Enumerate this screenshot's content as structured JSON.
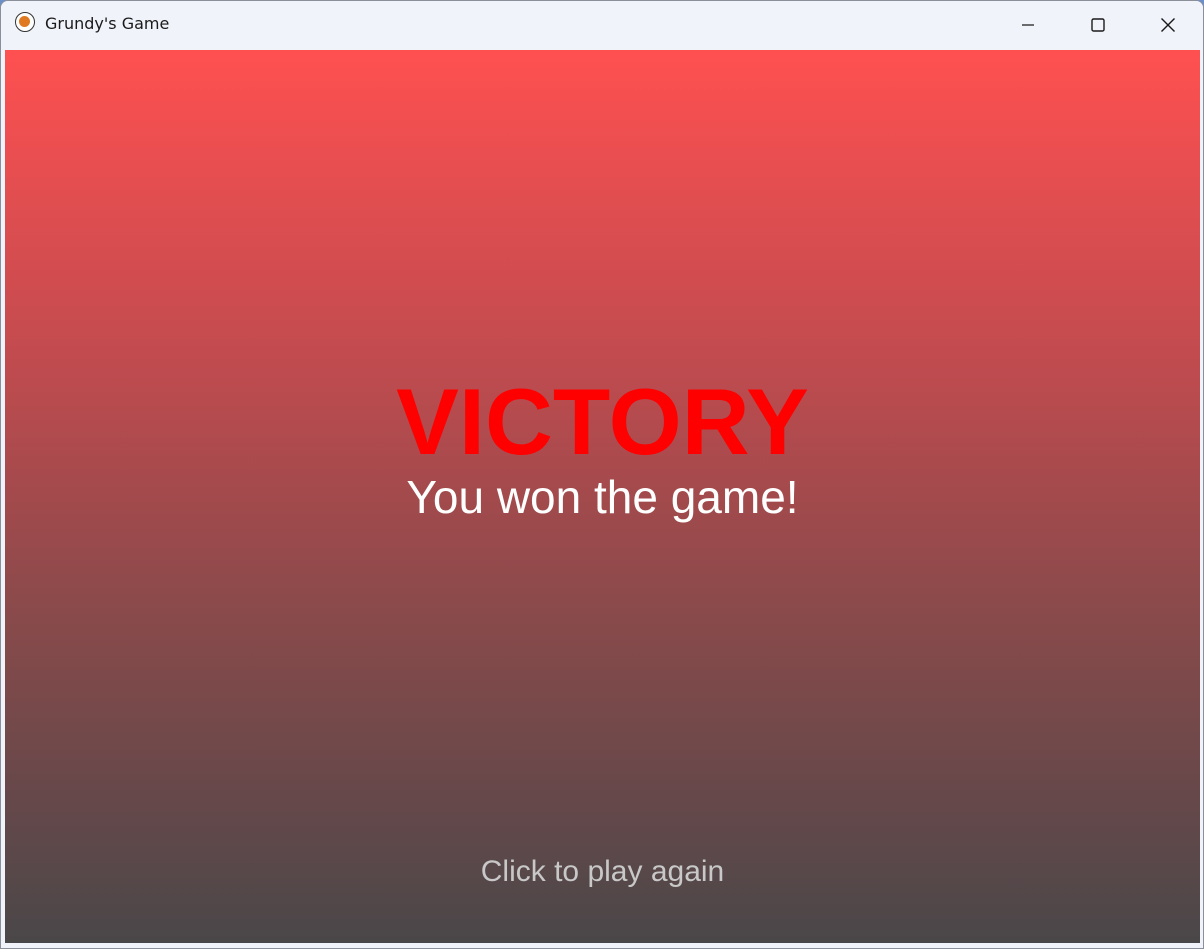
{
  "window": {
    "title": "Grundy's Game",
    "icon": "app-orb-icon",
    "controls": {
      "minimize_icon": "minimize-icon",
      "maximize_icon": "maximize-icon",
      "close_icon": "close-icon"
    }
  },
  "game": {
    "headline": "VICTORY",
    "message": "You won the game!",
    "prompt": "Click to play again"
  },
  "colors": {
    "headline": "#ff0000",
    "message": "#ffffff",
    "prompt": "#c8c8c8",
    "gradient_top": "#ff5050",
    "gradient_bottom": "#4a4749"
  }
}
